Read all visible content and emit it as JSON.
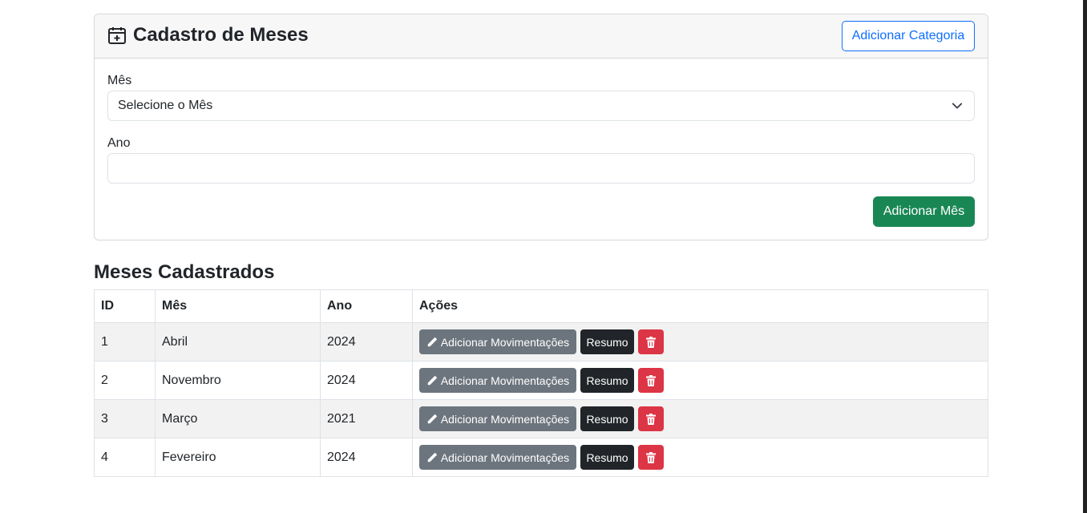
{
  "form_card": {
    "title": "Cadastro de Meses",
    "add_category_label": "Adicionar Categoria",
    "month_label": "Mês",
    "month_select_value": "Selecione o Mês",
    "year_label": "Ano",
    "year_value": "",
    "add_month_label": "Adicionar Mês"
  },
  "table": {
    "title": "Meses Cadastrados",
    "headers": [
      "ID",
      "Mês",
      "Ano",
      "Ações"
    ],
    "rows": [
      {
        "id": "1",
        "mes": "Abril",
        "ano": "2024"
      },
      {
        "id": "2",
        "mes": "Novembro",
        "ano": "2024"
      },
      {
        "id": "3",
        "mes": "Março",
        "ano": "2021"
      },
      {
        "id": "4",
        "mes": "Fevereiro",
        "ano": "2024"
      }
    ],
    "actions": {
      "add_movements_label": "Adicionar Movimentações",
      "summary_label": "Resumo"
    }
  },
  "colors": {
    "primary": "#0d6efd",
    "success": "#198754",
    "secondary": "#6c757d",
    "dark": "#212529",
    "danger": "#dc3545"
  },
  "icons": {
    "title_icon": "calendar-plus-icon",
    "select_icon": "chevron-down-icon",
    "edit_icon": "pencil-icon",
    "delete_icon": "trash-icon"
  }
}
